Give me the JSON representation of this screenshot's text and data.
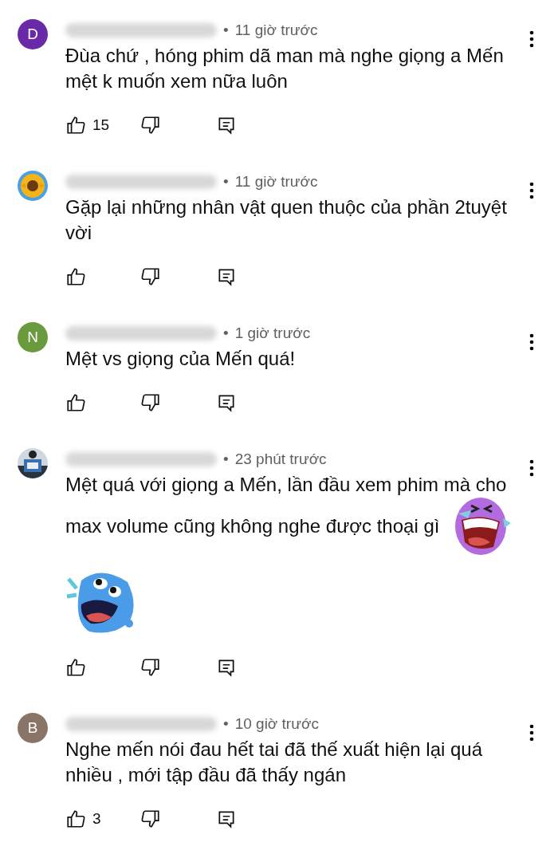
{
  "comments": [
    {
      "avatar": {
        "kind": "letter",
        "letter": "D",
        "color": "#6a2aa8"
      },
      "separator": "•",
      "time": "11 giờ trước",
      "text": "Đùa chứ , hóng phim dã man mà nghe giọng a Mến mệt k muốn xem nữa luôn",
      "likes": "15"
    },
    {
      "avatar": {
        "kind": "flower"
      },
      "separator": "•",
      "time": "11 giờ trước",
      "text": "Gặp lại những nhân vật quen thuộc  của phần 2tuyệt vời"
    },
    {
      "avatar": {
        "kind": "letter",
        "letter": "N",
        "color": "#6a9a3c"
      },
      "separator": "•",
      "time": "1 giờ trước",
      "text": "Mệt vs giọng của Mến quá!"
    },
    {
      "separator": "•",
      "time": "23 phút trước",
      "lines": [
        "Mệt quá với giọng a Mến, lần đầu xem phim mà cho",
        "max volume cũng không nghe được thoại gì"
      ],
      "stickers": [
        {
          "kind": "crying-laugh"
        },
        {
          "kind": "laugh"
        }
      ]
    },
    {
      "avatar": {
        "kind": "letter",
        "letter": "B",
        "color": "#8a7468"
      },
      "separator": "•",
      "time": "10 giờ trước",
      "text": "Nghe mến nói đau hết tai đã thế xuất hiện lại quá nhiều , mới tập đầu đã thấy ngán",
      "likes": "3"
    }
  ]
}
